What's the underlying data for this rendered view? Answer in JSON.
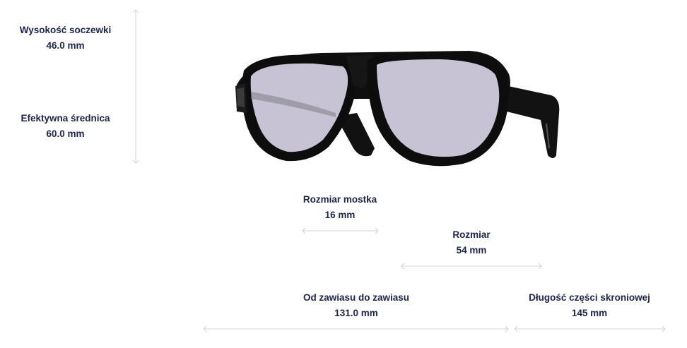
{
  "measurements": {
    "lens_height": {
      "label": "Wysokość soczewki",
      "value": "46.0 mm"
    },
    "effective_diameter": {
      "label": "Efektywna średnica",
      "value": "60.0 mm"
    },
    "bridge_size": {
      "label": "Rozmiar mostka",
      "value": "16 mm"
    },
    "lens_size": {
      "label": "Rozmiar",
      "value": "54 mm"
    },
    "hinge_to_hinge": {
      "label": "Od zawiasu do zawiasu",
      "value": "131.0 mm"
    },
    "temple_length": {
      "label": "Długość części skroniowej",
      "value": "145 mm"
    }
  },
  "colors": {
    "text": "#1c2547",
    "arrow": "#cfd3da",
    "frame": "#111111",
    "lens": "#c7c3d4"
  },
  "image": {
    "subject": "sunglasses-image"
  }
}
